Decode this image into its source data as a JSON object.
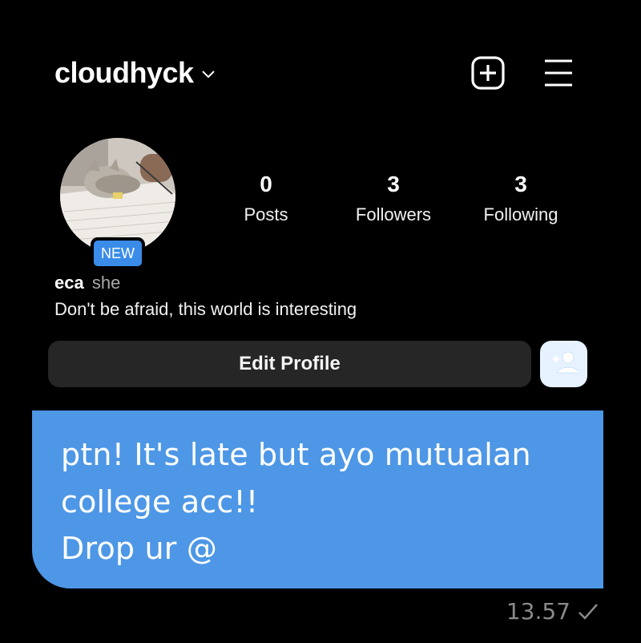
{
  "header": {
    "username": "cloudhyck",
    "icons": {
      "dropdown": "chevron-down-icon",
      "new_post": "plus-square-icon",
      "menu": "hamburger-menu-icon"
    }
  },
  "profile": {
    "badge": "NEW",
    "display_name": "eca",
    "pronouns": "she",
    "bio": "Don't be afraid, this world is interesting",
    "stats": [
      {
        "value": "0",
        "label": "Posts"
      },
      {
        "value": "3",
        "label": "Followers"
      },
      {
        "value": "3",
        "label": "Following"
      }
    ],
    "edit_label": "Edit Profile",
    "add_user_icon": "add-user-icon"
  },
  "message": {
    "lines": [
      "ptn! It's late but ayo mutualan",
      "college acc!!",
      "Drop ur @"
    ],
    "time": "13.57",
    "status_icon": "check-icon",
    "bubble_color": "#4d97e6"
  },
  "colors": {
    "background": "#000000",
    "badge": "#3a8ce8",
    "button": "#262626",
    "add_user_bg": "#e6f2ff"
  }
}
